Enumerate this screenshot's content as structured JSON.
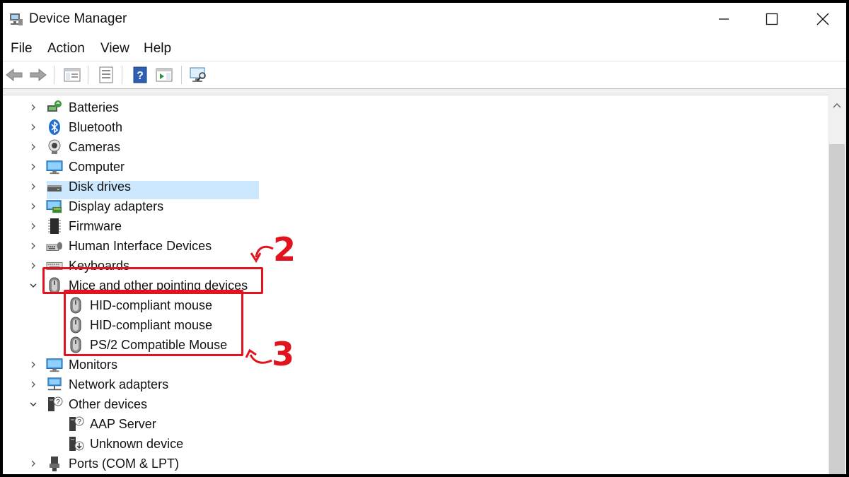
{
  "window": {
    "title": "Device Manager"
  },
  "menubar": {
    "items": [
      {
        "label": "File"
      },
      {
        "label": "Action"
      },
      {
        "label": "View"
      },
      {
        "label": "Help"
      }
    ]
  },
  "toolbar": {
    "buttons": [
      {
        "icon": "back-arrow-icon"
      },
      {
        "icon": "forward-arrow-icon"
      },
      {
        "icon": "show-hide-console-tree-icon"
      },
      {
        "icon": "properties-icon"
      },
      {
        "icon": "help-icon"
      },
      {
        "icon": "action-pane-icon"
      },
      {
        "icon": "scan-hardware-icon"
      }
    ]
  },
  "tree": {
    "items": [
      {
        "label": "Batteries",
        "icon": "battery-icon",
        "expanded": false,
        "level": 1
      },
      {
        "label": "Bluetooth",
        "icon": "bluetooth-icon",
        "expanded": false,
        "level": 1
      },
      {
        "label": "Cameras",
        "icon": "camera-icon",
        "expanded": false,
        "level": 1
      },
      {
        "label": "Computer",
        "icon": "computer-icon",
        "expanded": false,
        "level": 1
      },
      {
        "label": "Disk drives",
        "icon": "disk-drive-icon",
        "expanded": false,
        "level": 1
      },
      {
        "label": "Display adapters",
        "icon": "display-adapter-icon",
        "expanded": false,
        "level": 1
      },
      {
        "label": "Firmware",
        "icon": "firmware-icon",
        "expanded": false,
        "level": 1
      },
      {
        "label": "Human Interface Devices",
        "icon": "hid-icon",
        "expanded": false,
        "level": 1
      },
      {
        "label": "Keyboards",
        "icon": "keyboard-icon",
        "expanded": false,
        "level": 1
      },
      {
        "label": "Mice and other pointing devices",
        "icon": "mouse-icon",
        "expanded": true,
        "level": 1,
        "selected": true
      },
      {
        "label": "HID-compliant mouse",
        "icon": "mouse-icon",
        "level": 2
      },
      {
        "label": "HID-compliant mouse",
        "icon": "mouse-icon",
        "level": 2
      },
      {
        "label": "PS/2 Compatible Mouse",
        "icon": "mouse-icon",
        "level": 2
      },
      {
        "label": "Monitors",
        "icon": "monitor-icon",
        "expanded": false,
        "level": 1
      },
      {
        "label": "Network adapters",
        "icon": "network-adapter-icon",
        "expanded": false,
        "level": 1
      },
      {
        "label": "Other devices",
        "icon": "other-devices-icon",
        "expanded": true,
        "level": 1
      },
      {
        "label": "AAP Server",
        "icon": "unknown-device-icon",
        "level": 2
      },
      {
        "label": "Unknown device",
        "icon": "unknown-device-icon",
        "level": 2
      },
      {
        "label": "Ports (COM & LPT)",
        "icon": "port-icon",
        "expanded": false,
        "level": 1
      }
    ]
  },
  "annotations": {
    "step2": "2",
    "step3": "3",
    "color": "#e0141e"
  },
  "colors": {
    "selection": "#cce8ff",
    "annotation": "#e0141e"
  }
}
